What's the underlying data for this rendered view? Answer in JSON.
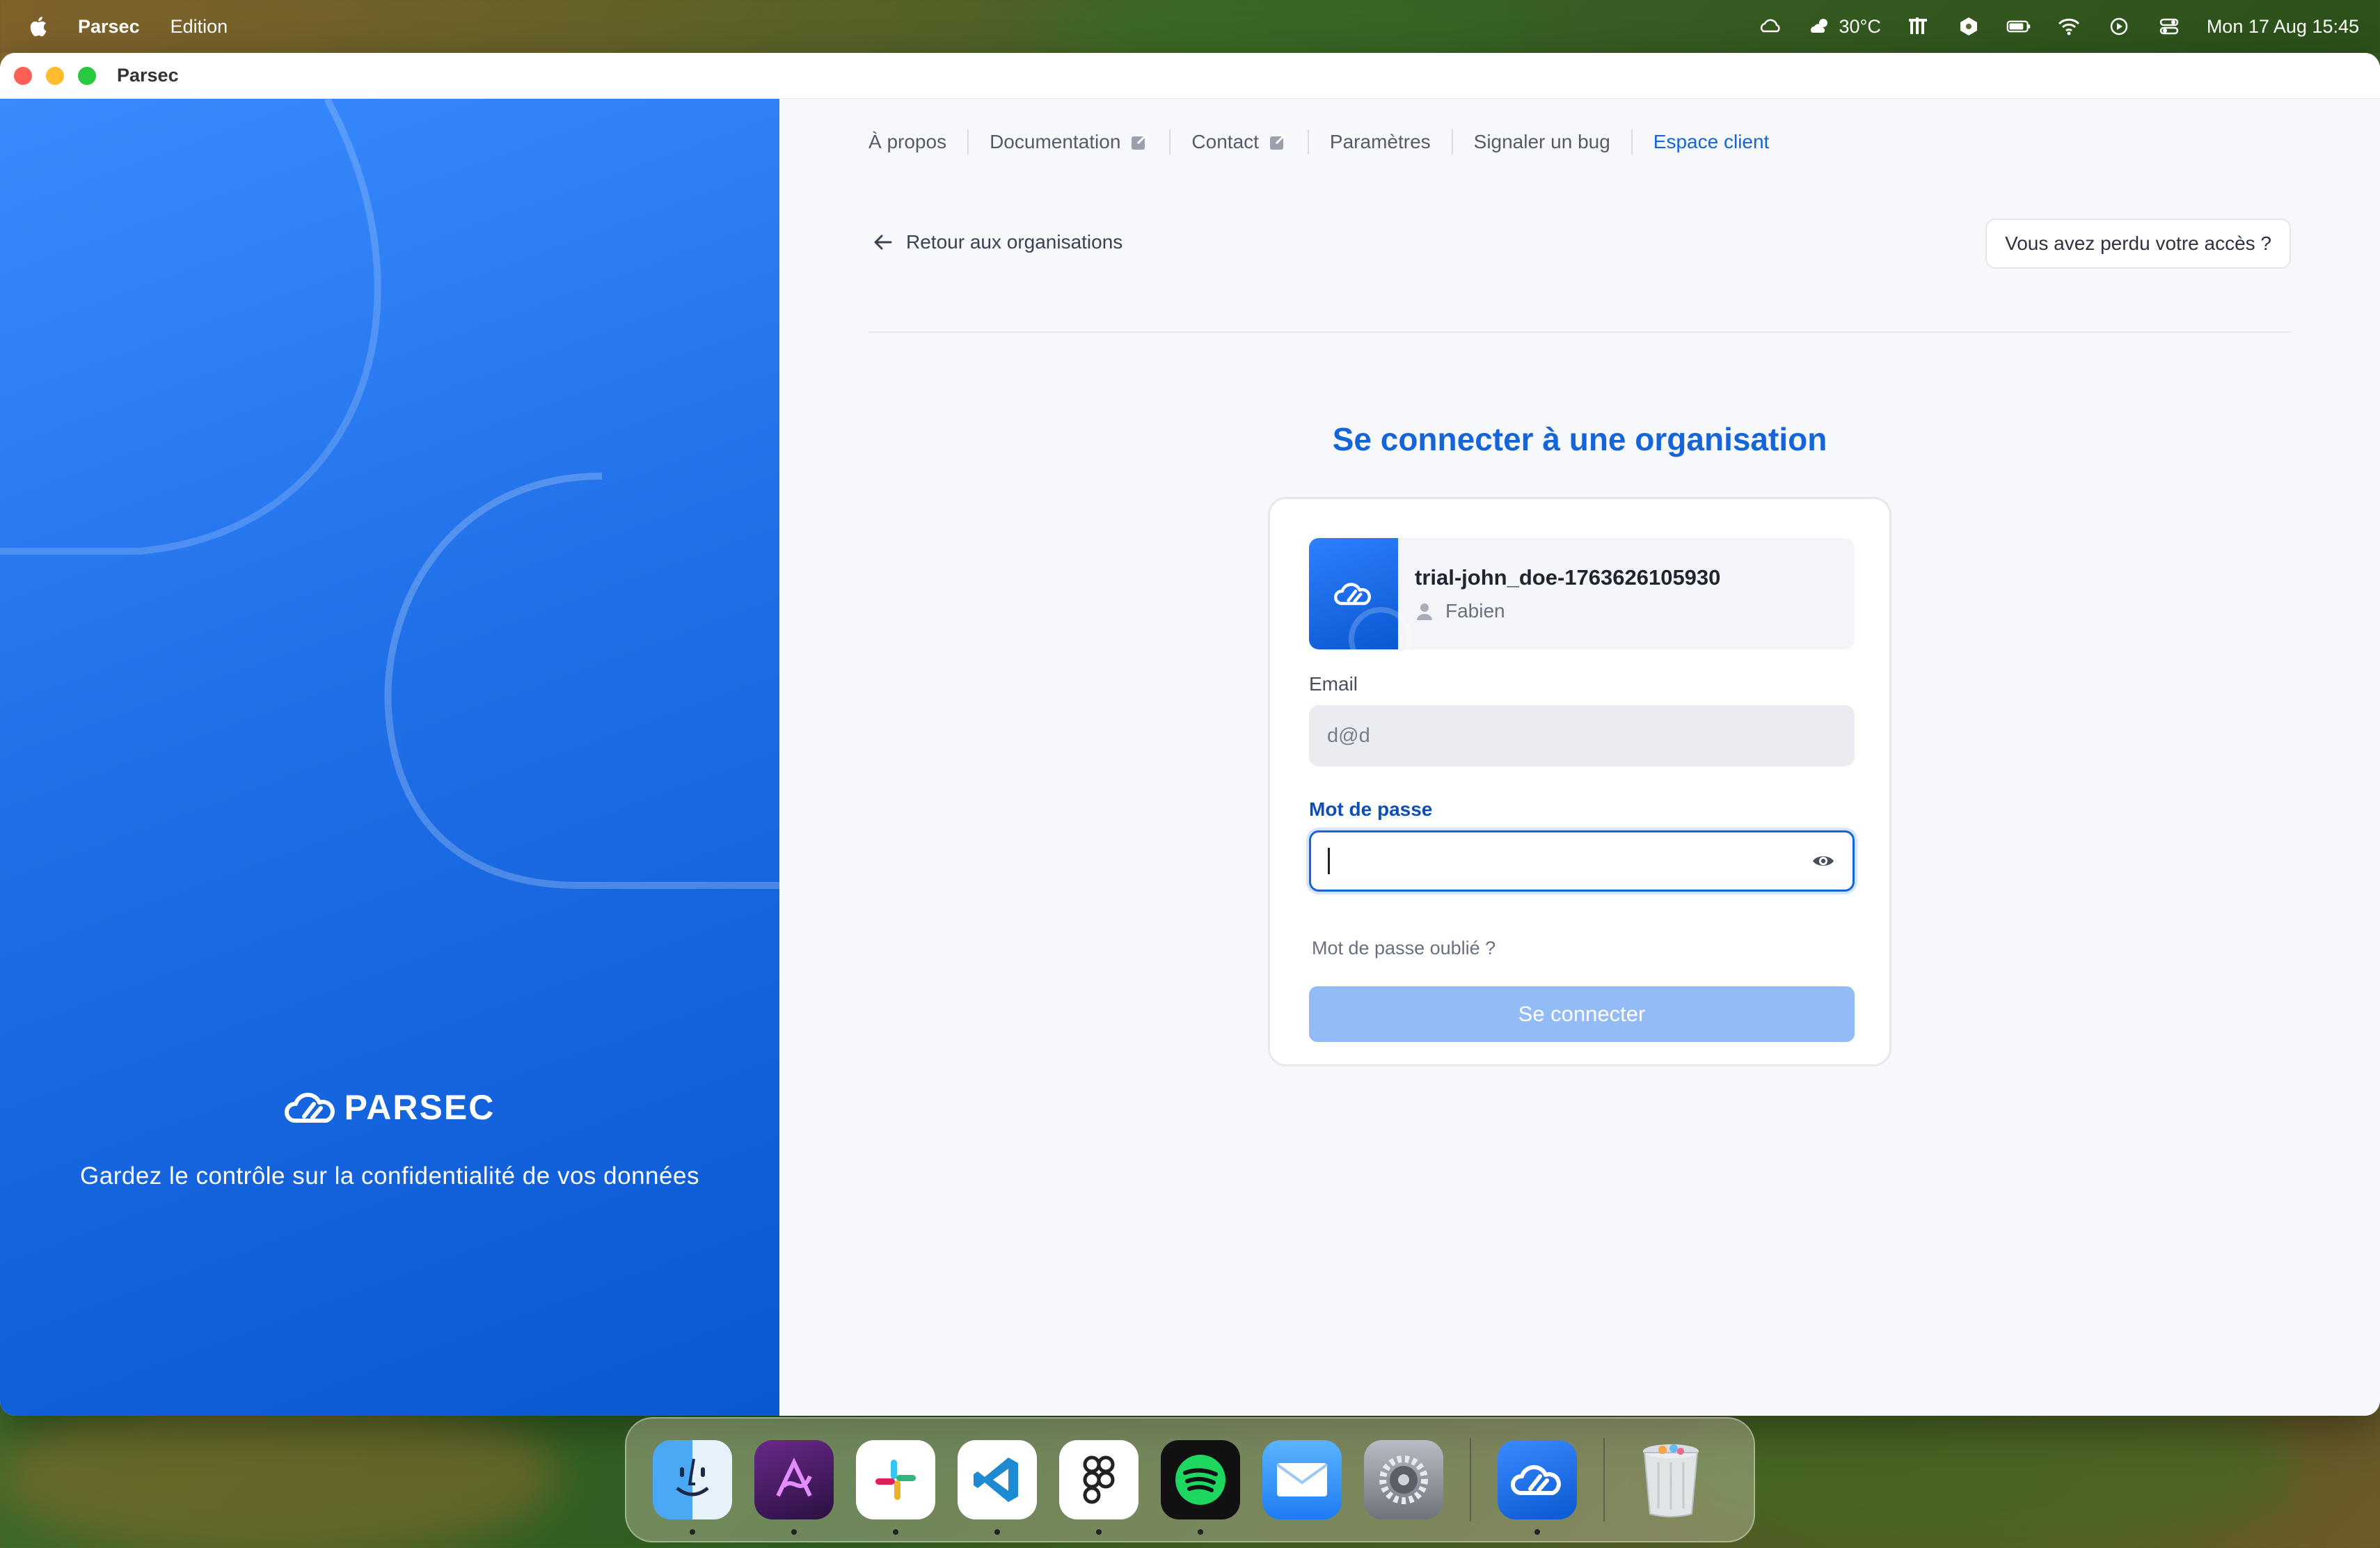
{
  "menubar": {
    "app_name": "Parsec",
    "menu_edition": "Edition",
    "weather": "30°C",
    "datetime": "Mon 17 Aug  15:45"
  },
  "window": {
    "title": "Parsec"
  },
  "brand": {
    "logo_text": "PARSEC",
    "tagline": "Gardez le contrôle sur la confidentialité de vos données"
  },
  "nav": {
    "about": "À propos",
    "documentation": "Documentation",
    "contact": "Contact",
    "settings": "Paramètres",
    "report_bug": "Signaler un bug",
    "customer_area": "Espace client"
  },
  "back_link": "Retour aux organisations",
  "lost_access_button": "Vous avez perdu votre accès ?",
  "page_title": "Se connecter à une organisation",
  "organization": {
    "name": "trial-john_doe-1763626105930",
    "user": "Fabien"
  },
  "form": {
    "email_label": "Email",
    "email_value": "d@d",
    "password_label": "Mot de passe",
    "password_value": "",
    "forgot_password": "Mot de passe oublié ?",
    "submit": "Se connecter"
  },
  "colors": {
    "accent": "#1565d8",
    "brand_panel": "#1f6fe8",
    "button_disabled": "#93bcf7"
  },
  "dock": {
    "apps": [
      "finder-icon",
      "affinity-icon",
      "slack-icon",
      "vscode-icon",
      "figma-icon",
      "spotify-icon",
      "mail-icon",
      "system-settings-icon",
      "parsec-icon",
      "trash-icon"
    ]
  }
}
